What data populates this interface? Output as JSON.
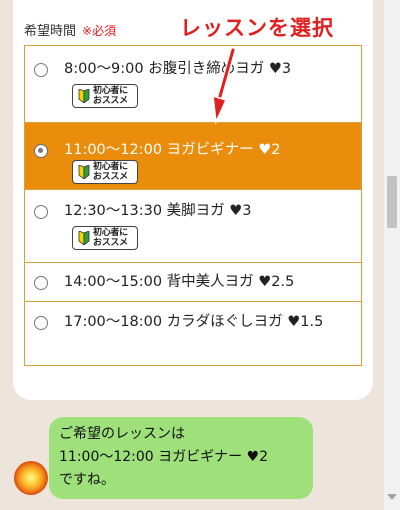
{
  "form": {
    "label": "希望時間",
    "required": "※必須",
    "badge_line1": "初心者に",
    "badge_line2": "おススメ",
    "options": [
      {
        "text": "8:00〜9:00 お腹引き締めヨガ ♥3",
        "selected": false,
        "beginner": true
      },
      {
        "text": "11:00〜12:00 ヨガビギナー ♥2",
        "selected": true,
        "beginner": true
      },
      {
        "text": "12:30〜13:30 美脚ヨガ ♥3",
        "selected": false,
        "beginner": true
      },
      {
        "text": "14:00〜15:00 背中美人ヨガ ♥2.5",
        "selected": false,
        "beginner": false
      },
      {
        "text": "17:00〜18:00 カラダほぐしヨガ ♥1.5",
        "selected": false,
        "beginner": false
      }
    ]
  },
  "annotation": {
    "text": "レッスンを選択"
  },
  "chat": {
    "message": "ご希望のレッスンは\n11:00〜12:00 ヨガビギナー ♥2\nですね。"
  },
  "colors": {
    "selected_bg": "#ea8c0c",
    "border": "#d8a13a",
    "bubble": "#9ee07a",
    "required": "#e01a1a",
    "annotation": "#e21f1f"
  },
  "icons": {
    "beginner_mark": "beginner-leaf-icon"
  }
}
